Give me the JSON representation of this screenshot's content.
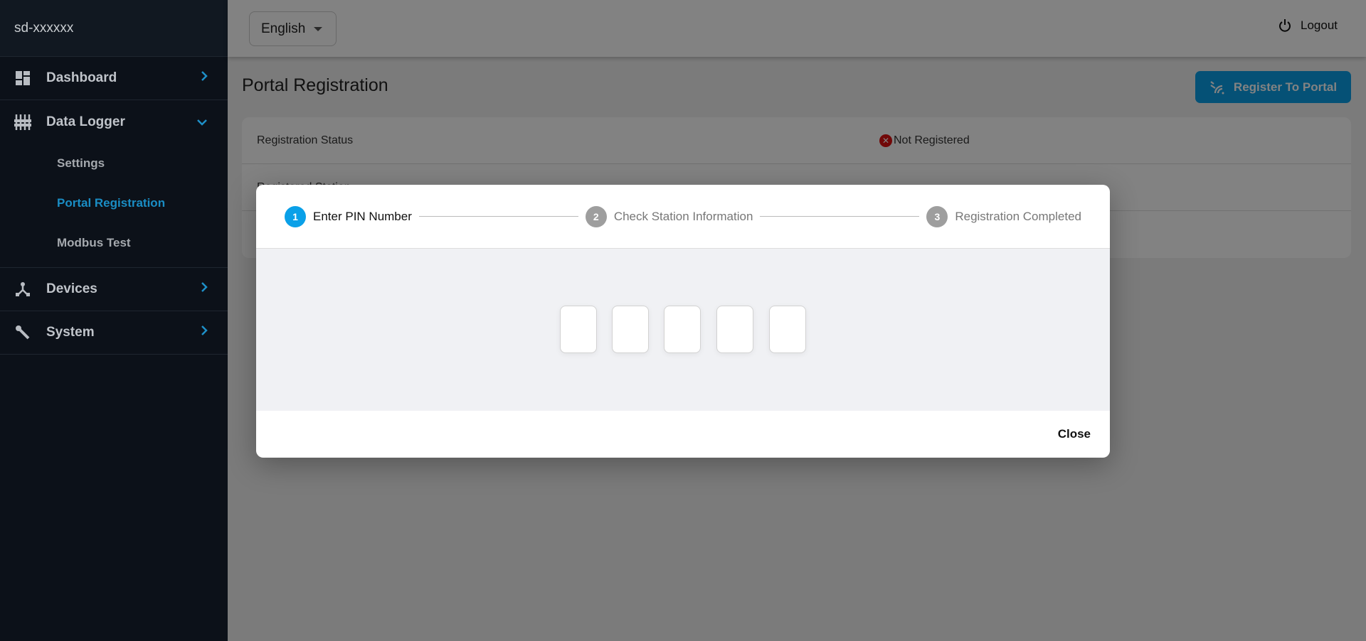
{
  "sidebar": {
    "brand": "sd-xxxxxx",
    "items": [
      {
        "label": "Dashboard",
        "icon": "dashboard-icon"
      },
      {
        "label": "Data Logger",
        "icon": "sliders-icon",
        "expanded": true,
        "children": [
          "Settings",
          "Portal Registration",
          "Modbus Test"
        ]
      },
      {
        "label": "Devices",
        "icon": "network-icon"
      },
      {
        "label": "System",
        "icon": "wrench-icon"
      }
    ],
    "active": "Portal Registration"
  },
  "header": {
    "language": "English",
    "logout": "Logout"
  },
  "main": {
    "title": "Portal Registration",
    "register_button": "Register To Portal",
    "rows": [
      {
        "label": "Registration Status",
        "value": "Not Registered"
      },
      {
        "label": "Registered Station"
      }
    ]
  },
  "modal": {
    "steps": [
      {
        "num": "1",
        "label": "Enter PIN Number",
        "active": true
      },
      {
        "num": "2",
        "label": "Check Station Information"
      },
      {
        "num": "3",
        "label": "Registration Completed"
      }
    ],
    "pin_length": 5,
    "close": "Close"
  },
  "colors": {
    "accent": "#0aa0e8",
    "sidebar": "#0c1119",
    "error": "#dd1111"
  }
}
